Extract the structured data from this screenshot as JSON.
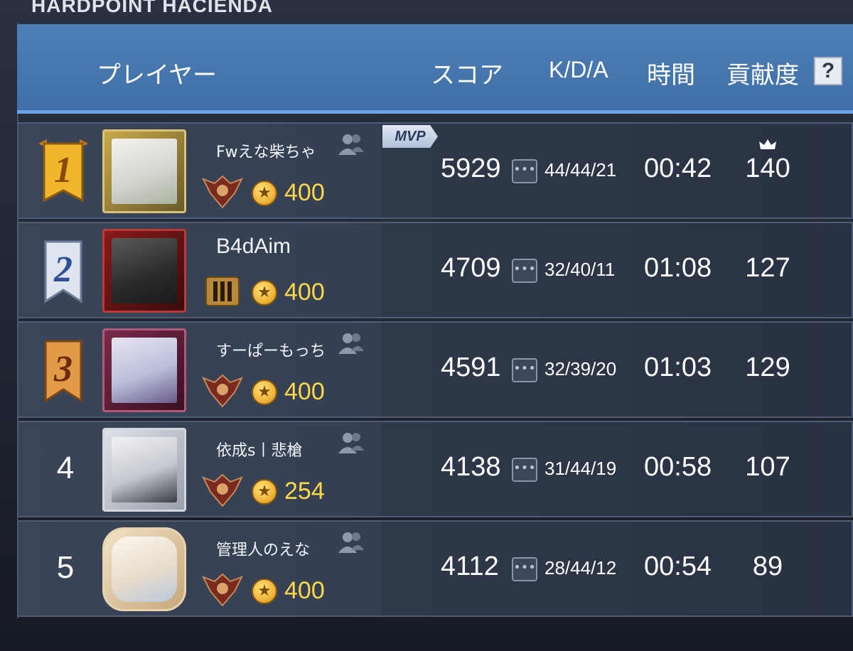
{
  "mode_title": "HARDPOINT  HACIENDA",
  "header": {
    "player": "プレイヤー",
    "score": "スコア",
    "kda": "K/D/A",
    "time": "時間",
    "contribution": "貢献度",
    "help": "?"
  },
  "mvp_label": "MVP",
  "rows": [
    {
      "rank": "1",
      "name": "Fwえな柴ちゃ",
      "coins": "400",
      "score": "5929",
      "kda": "44/44/21",
      "time": "00:42",
      "contribution": "140",
      "ribbon": "gold",
      "emblem": "wings",
      "mvp": true
    },
    {
      "rank": "2",
      "name": "B4dAim",
      "coins": "400",
      "score": "4709",
      "kda": "32/40/11",
      "time": "01:08",
      "contribution": "127",
      "ribbon": "silver",
      "emblem": "bars"
    },
    {
      "rank": "3",
      "name": "すーぱーもっち",
      "coins": "400",
      "score": "4591",
      "kda": "32/39/20",
      "time": "01:03",
      "contribution": "129",
      "ribbon": "bronze",
      "emblem": "wings"
    },
    {
      "rank": "4",
      "name": "依成s丨悲槍",
      "coins": "254",
      "score": "4138",
      "kda": "31/44/19",
      "time": "00:58",
      "contribution": "107",
      "ribbon": "none",
      "emblem": "wings"
    },
    {
      "rank": "5",
      "name": "管理人のえな",
      "coins": "400",
      "score": "4112",
      "kda": "28/44/12",
      "time": "00:54",
      "contribution": "89",
      "ribbon": "none",
      "emblem": "wings"
    }
  ],
  "colors": {
    "header_bg": "#4677ae",
    "accent_line": "#6aa3e6",
    "coin_text": "#ffd84a",
    "gold": "#f0b72d",
    "silver": "#d7deea",
    "bronze": "#d98e3d"
  }
}
